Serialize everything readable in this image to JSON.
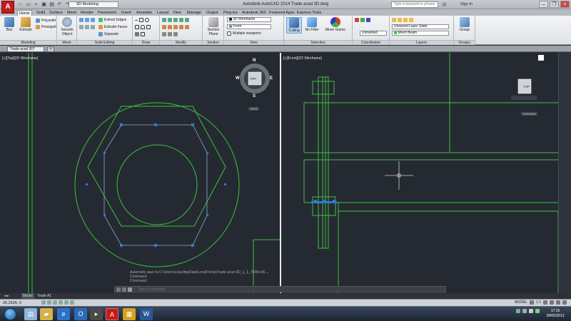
{
  "app": {
    "logo_letter": "A",
    "title": "Autodesk AutoCAD 2014   Trade acad 3D.dwg",
    "workspace": "3D Modeling",
    "search_placeholder": "Type a keyword or phrase",
    "sign_in": "Sign In"
  },
  "tabs": [
    "Home",
    "Solid",
    "Surface",
    "Mesh",
    "Render",
    "Parametric",
    "Insert",
    "Annotate",
    "Layout",
    "View",
    "Manage",
    "Output",
    "Plug-ins",
    "Autodesk 360",
    "Featured Apps",
    "Express Tools"
  ],
  "ribbon": {
    "modeling": {
      "title": "Modeling",
      "box": "Box",
      "extrude": "Extrude",
      "polysolid": "Polysolid",
      "presspull": "Presspull"
    },
    "mesh": {
      "title": "Mesh",
      "smooth_object": "Smooth Object"
    },
    "solid_editing": {
      "title": "Solid Editing",
      "extract_edges": "Extract Edges",
      "extrude_faces": "Extrude Faces",
      "separate": "Separate"
    },
    "draw": {
      "title": "Draw"
    },
    "modify": {
      "title": "Modify"
    },
    "section": {
      "title": "Section",
      "section_plane": "Section Plane"
    },
    "view": {
      "title": "View",
      "visual_style": "3D Wireframe",
      "view_name": "Front",
      "multiple_viewports": "Multiple viewports"
    },
    "selection": {
      "title": "Selection",
      "culling": "Culling",
      "no_filter": "No Filter",
      "move_gizmo": "Move Gizmo"
    },
    "coordinates": {
      "title": "Coordinates",
      "ucs": "Unnamed"
    },
    "layers": {
      "title": "Layers",
      "layer_state": "Unsaved Layer State",
      "current_layer": "Mesh Beam"
    },
    "groups": {
      "title": "Groups",
      "group": "Group"
    }
  },
  "document": {
    "tab_name": "Trade acad 3D*",
    "new_tab": "+"
  },
  "viewports": {
    "left": {
      "label": "[+][Top][2D Wireframe]",
      "compass": {
        "n": "N",
        "s": "S",
        "e": "E",
        "w": "W",
        "cube_face": "TOP"
      },
      "wcs": "WCS"
    },
    "right": {
      "label": "[+][Front][2D Wireframe]",
      "cube_face": "TOP",
      "ucs": "Unnamed"
    }
  },
  "command": {
    "history": [
      "Automatic save to C:\\Users\\e-lay\\AppData\\Local\\Temp\\Trade acad 3D_1_1_7038.sv$ ...",
      "Command:",
      "Command:"
    ],
    "placeholder": "Type a command"
  },
  "layout_tabs": [
    "Model",
    "Trade A1"
  ],
  "status": {
    "coords": "26.2526, 0",
    "model": "MODEL",
    "scale": "1:1"
  },
  "taskbar": {
    "clock_time": "17:15",
    "clock_date": "28/05/2013"
  },
  "colors": {
    "accent": "#1f6fc5",
    "geometry": "#3fbf3f",
    "grip": "#2d7bd6",
    "autocad_red": "#c41b1b"
  }
}
